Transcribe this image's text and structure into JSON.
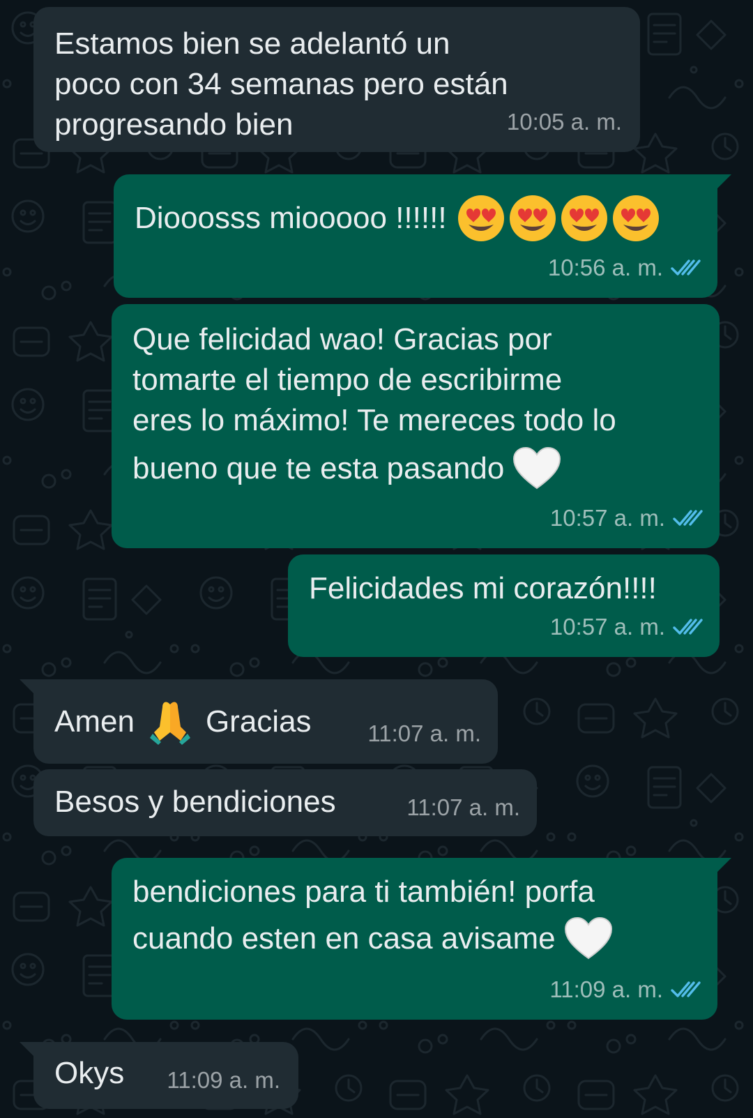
{
  "colors": {
    "background": "#0b141a",
    "incoming_bubble": "#202c33",
    "outgoing_bubble": "#005c4b",
    "text": "#e9edef",
    "read_ticks": "#53bdeb"
  },
  "messages": [
    {
      "direction": "incoming",
      "lines": [
        "Estamos bien se adelantó un",
        "poco con 34 semanas pero están",
        "progresando bien"
      ],
      "time": "10:05 a. m."
    },
    {
      "direction": "outgoing",
      "lines": [
        "Diooosss miooooo !!!!!!"
      ],
      "emoji": [
        "heart-eyes-emoji",
        "heart-eyes-emoji",
        "heart-eyes-emoji",
        "heart-eyes-emoji"
      ],
      "time": "10:56 a. m.",
      "status": "read"
    },
    {
      "direction": "outgoing",
      "lines": [
        "Que felicidad wao! Gracias por",
        "tomarte el tiempo de escribirme",
        "eres lo máximo! Te mereces todo lo",
        "bueno que te esta pasando"
      ],
      "emoji": [
        "white-heart-emoji"
      ],
      "time": "10:57 a. m.",
      "status": "read"
    },
    {
      "direction": "outgoing",
      "lines": [
        "Felicidades mi corazón!!!!"
      ],
      "time": "10:57 a. m.",
      "status": "read"
    },
    {
      "direction": "incoming",
      "lines": [
        "Amen",
        "Gracias"
      ],
      "emoji": [
        "folded-hands-emoji"
      ],
      "time": "11:07 a. m."
    },
    {
      "direction": "incoming",
      "lines": [
        "Besos y bendiciones"
      ],
      "time": "11:07 a. m."
    },
    {
      "direction": "outgoing",
      "lines": [
        "bendiciones para ti también! porfa",
        "cuando esten en casa avisame"
      ],
      "emoji": [
        "white-heart-emoji"
      ],
      "time": "11:09 a. m.",
      "status": "read"
    },
    {
      "direction": "incoming",
      "lines": [
        "Okys"
      ],
      "time": "11:09 a. m."
    }
  ]
}
